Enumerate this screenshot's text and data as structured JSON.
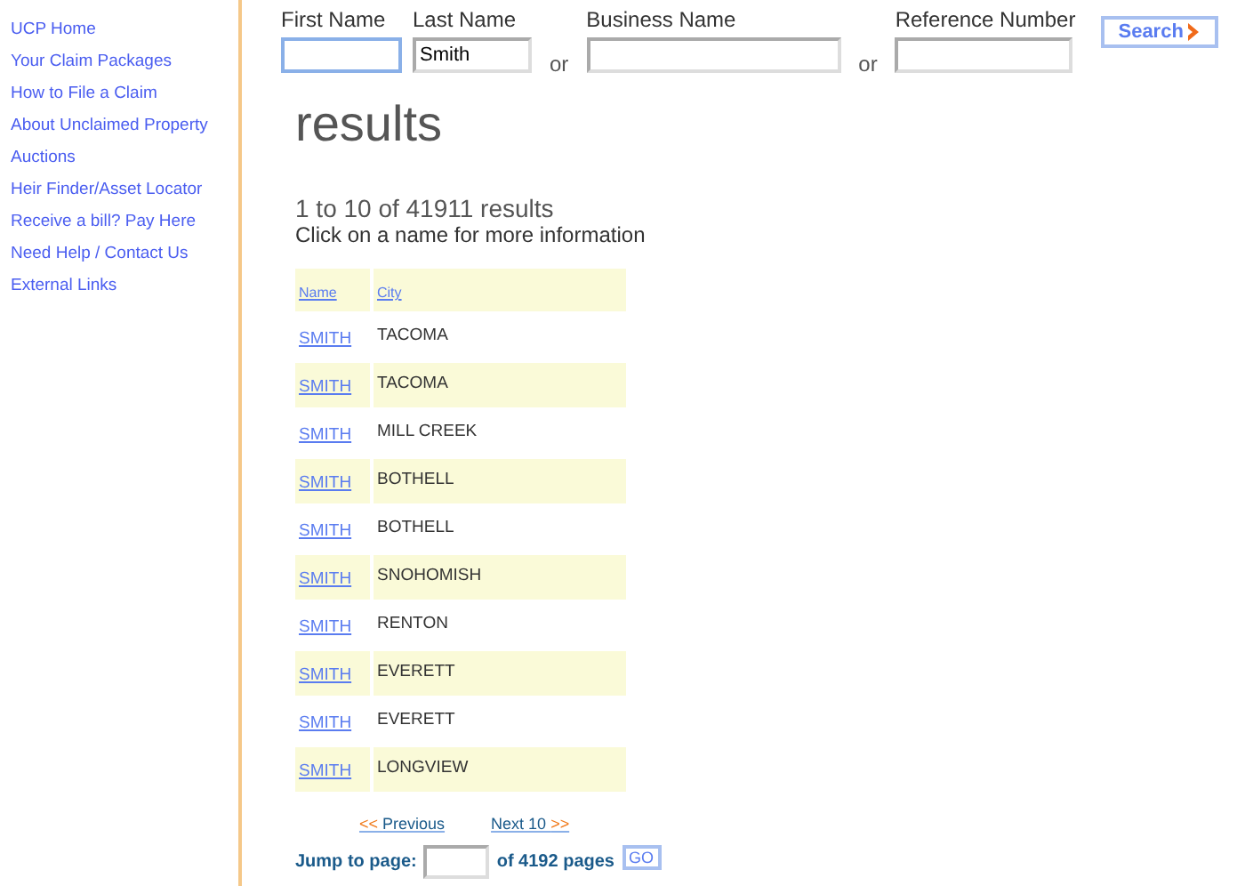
{
  "sidebar": {
    "items": [
      "UCP Home",
      "Your Claim Packages",
      "How to File a Claim",
      "About Unclaimed Property",
      "Auctions",
      "Heir Finder/Asset Locator",
      "Receive a bill? Pay Here",
      "Need Help / Contact Us",
      "External Links"
    ]
  },
  "search": {
    "fields": [
      {
        "label": "First Name",
        "focused": true
      },
      {
        "label": "Last Name",
        "value": "Smith",
        "focused": false
      },
      {
        "label": "Business Name",
        "focused": false
      },
      {
        "label": "Reference Number",
        "focused": false
      }
    ],
    "separators": [
      "or",
      "or"
    ],
    "button": "Search"
  },
  "heading": "results",
  "summary": "1 to 10 of 41911 results",
  "hint": "Click on a name for more information",
  "table": {
    "columns": [
      "Name",
      "City"
    ],
    "rows": [
      {
        "name": "SMITH",
        "city": "TACOMA"
      },
      {
        "name": "SMITH",
        "city": "TACOMA"
      },
      {
        "name": "SMITH",
        "city": "MILL CREEK"
      },
      {
        "name": "SMITH",
        "city": "BOTHELL"
      },
      {
        "name": "SMITH",
        "city": "BOTHELL"
      },
      {
        "name": "SMITH",
        "city": "SNOHOMISH"
      },
      {
        "name": "SMITH",
        "city": "RENTON"
      },
      {
        "name": "SMITH",
        "city": "EVERETT"
      },
      {
        "name": "SMITH",
        "city": "EVERETT"
      },
      {
        "name": "SMITH",
        "city": "LONGVIEW"
      }
    ]
  },
  "pager": {
    "previous": {
      "arrow": "<<",
      "label": "Previous"
    },
    "next": {
      "label": "Next 10",
      "arrow": ">>"
    },
    "jump_label": "Jump to page:",
    "total": "of 4192 pages",
    "go": "GO"
  }
}
